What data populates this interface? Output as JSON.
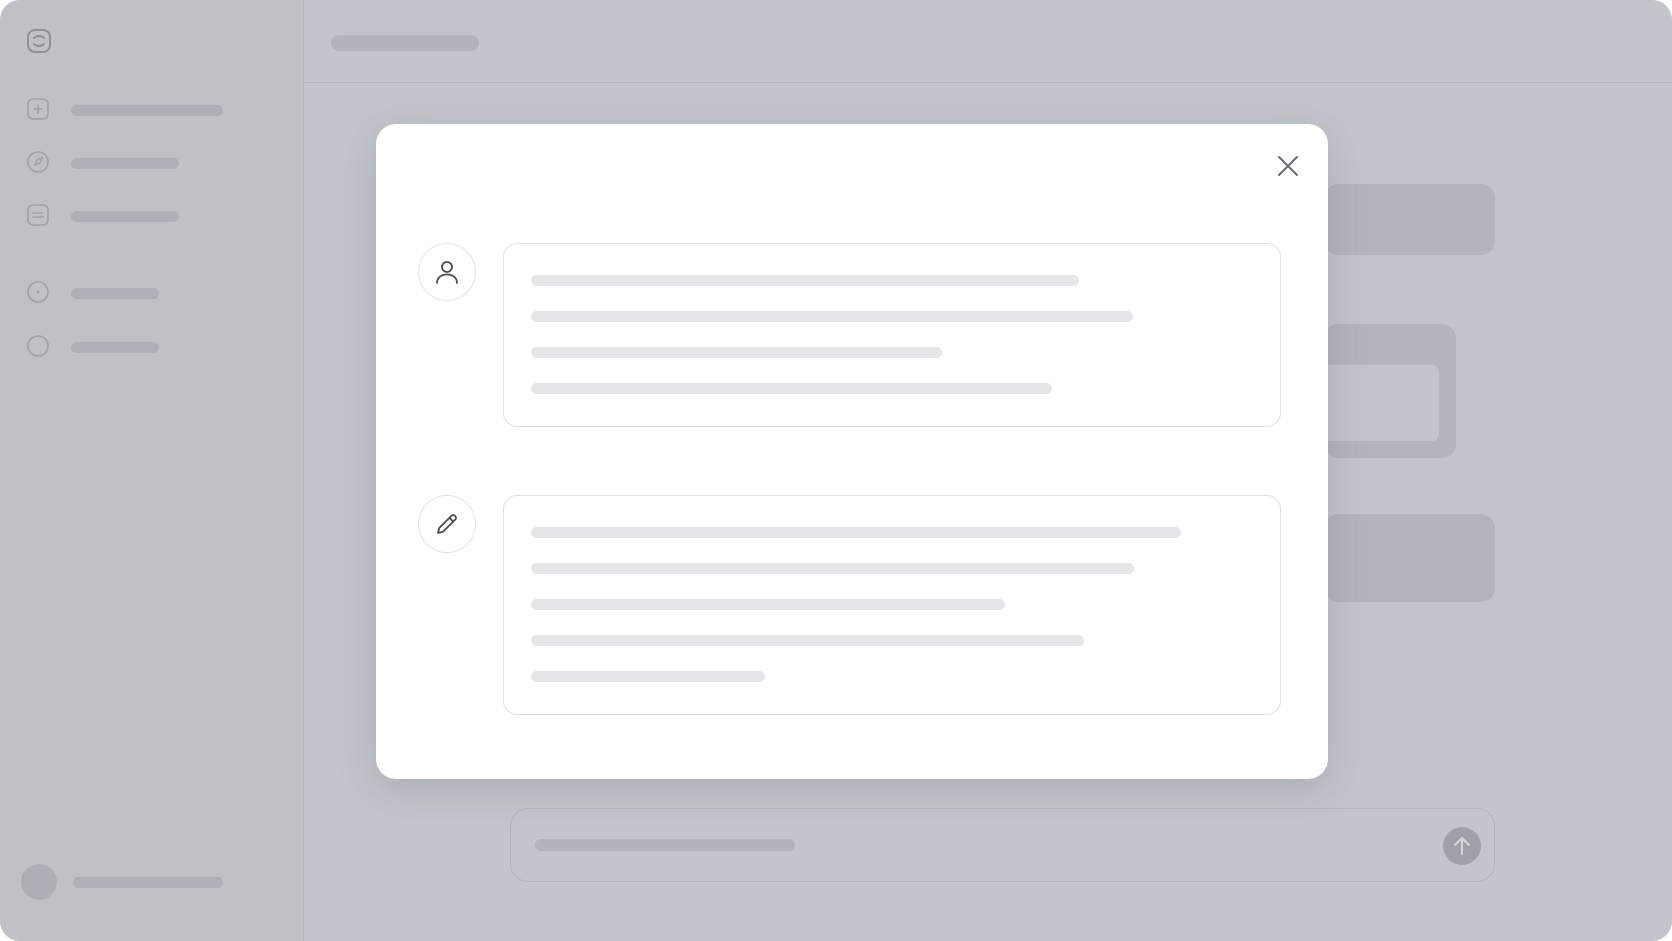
{
  "app": {
    "window_title": ""
  },
  "sidebar": {
    "logo_icon": "app-logo-icon",
    "items": [
      {
        "icon": "new-chat-icon",
        "label": ""
      },
      {
        "icon": "explore-icon",
        "label": ""
      },
      {
        "icon": "library-icon",
        "label": ""
      },
      {
        "icon": "add-circle-icon",
        "label": ""
      },
      {
        "icon": "circle-icon",
        "label": ""
      }
    ],
    "profile": {
      "icon": "avatar",
      "name": ""
    }
  },
  "main": {
    "header": {
      "title": ""
    },
    "composer": {
      "placeholder": "",
      "send_icon": "arrow-up-icon"
    }
  },
  "modal": {
    "close_icon": "close-icon",
    "sections": [
      {
        "icon": "user-icon",
        "text_lines": 4
      },
      {
        "icon": "pencil-icon",
        "text_lines": 5
      }
    ]
  },
  "colors": {
    "overlay": "#c3c5cc",
    "modal_bg": "#ffffff",
    "skeleton": "#e6e7e9",
    "icon_stroke": "#4a4b50"
  }
}
